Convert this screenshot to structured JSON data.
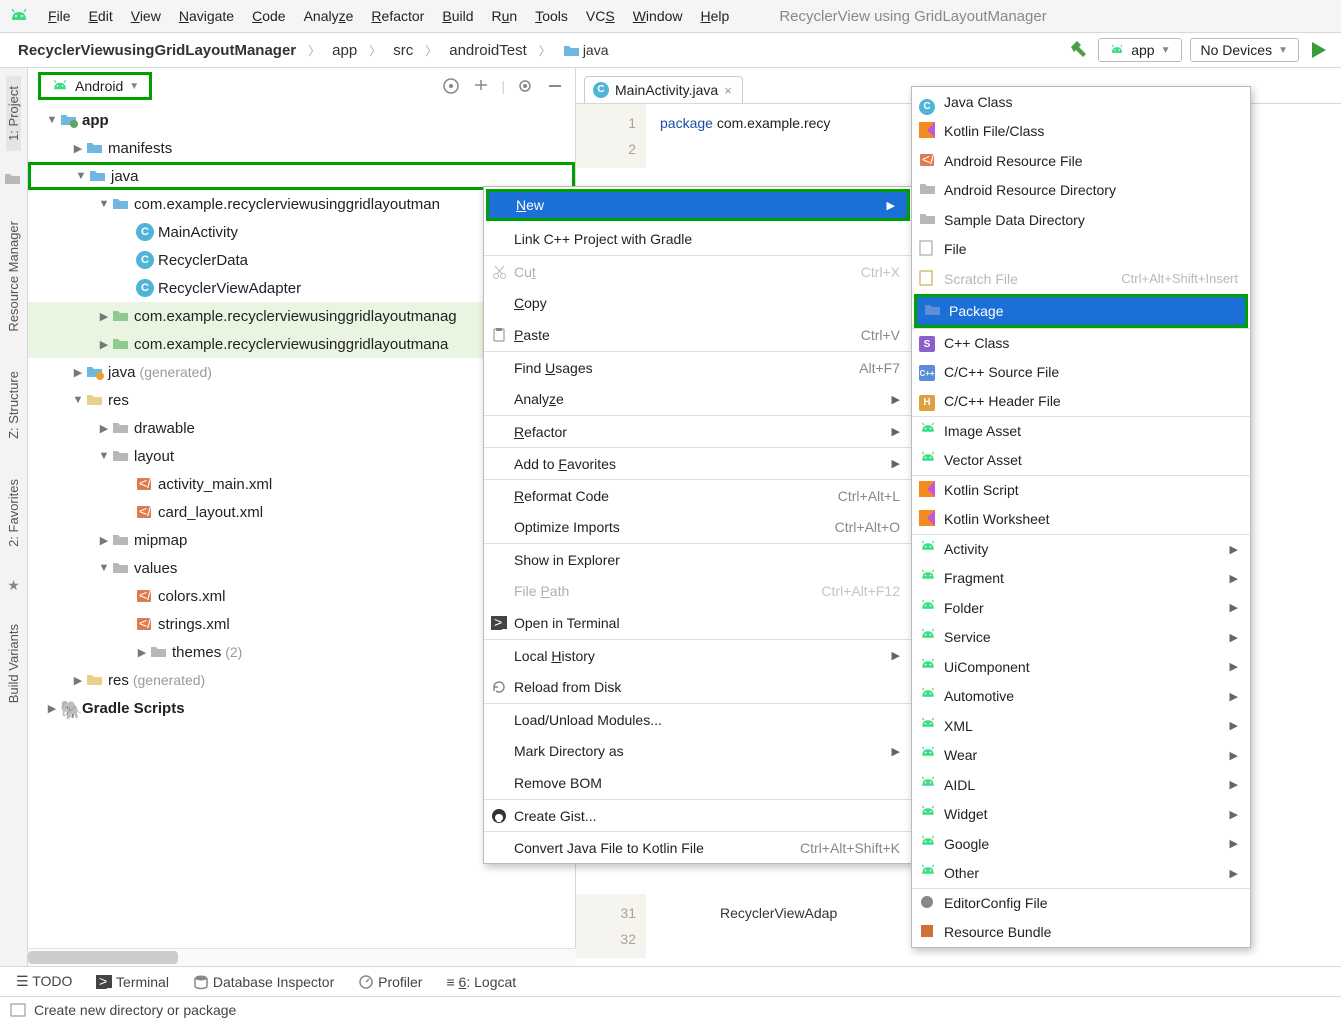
{
  "menubar": {
    "items": [
      "File",
      "Edit",
      "View",
      "Navigate",
      "Code",
      "Analyze",
      "Refactor",
      "Build",
      "Run",
      "Tools",
      "VCS",
      "Window",
      "Help"
    ],
    "hint": "RecyclerView using GridLayoutManager"
  },
  "breadcrumbs": {
    "project": "RecyclerViewusingGridLayoutManager",
    "parts": [
      "app",
      "src",
      "androidTest",
      "java"
    ]
  },
  "toolbar_right": {
    "config": "app",
    "devices": "No Devices"
  },
  "sidebar_tabs": {
    "top": "1: Project",
    "others": [
      "Resource Manager",
      "Z: Structure",
      "2: Favorites",
      "Build Variants"
    ]
  },
  "project_panel": {
    "selector": "Android",
    "tree": {
      "app": "app",
      "manifests": "manifests",
      "java": "java",
      "pkg1": "com.example.recyclerviewusinggridlayoutman",
      "cls": [
        "MainActivity",
        "RecyclerData",
        "RecyclerViewAdapter"
      ],
      "pkg_test1": "com.example.recyclerviewusinggridlayoutmanag",
      "pkg_test2": "com.example.recyclerviewusinggridlayoutmana",
      "java_gen": "java",
      "java_gen_suffix": "(generated)",
      "res": "res",
      "drawable": "drawable",
      "layout": "layout",
      "layout_files": [
        "activity_main.xml",
        "card_layout.xml"
      ],
      "mipmap": "mipmap",
      "values": "values",
      "values_files": [
        "colors.xml",
        "strings.xml"
      ],
      "themes": "themes",
      "themes_suffix": "(2)",
      "res_gen": "res",
      "res_gen_suffix": "(generated)",
      "gradle": "Gradle Scripts"
    }
  },
  "editor": {
    "tab": "MainActivity.java",
    "line1_kw": "package",
    "line1_rest": " com.example.recy",
    "gutter_first": [
      "1",
      "2"
    ],
    "gutter31": "31",
    "gutter32": "32",
    "line31": "RecyclerViewAdap"
  },
  "context_menu": [
    {
      "label": "New",
      "shortcut": "",
      "type": "new"
    },
    {
      "label": "Link C++ Project with Gradle",
      "type": "item",
      "sep": false
    },
    {
      "label": "Cut",
      "shortcut": "Ctrl+X",
      "type": "disabled",
      "sep": true,
      "icon": "cut"
    },
    {
      "label": "Copy",
      "shortcut": "",
      "type": "item"
    },
    {
      "label": "Paste",
      "shortcut": "Ctrl+V",
      "type": "item",
      "icon": "paste"
    },
    {
      "label": "Find Usages",
      "shortcut": "Alt+F7",
      "type": "item",
      "sep": true
    },
    {
      "label": "Analyze",
      "shortcut": "",
      "type": "submenu"
    },
    {
      "label": "Refactor",
      "shortcut": "",
      "type": "submenu",
      "sep": true
    },
    {
      "label": "Add to Favorites",
      "shortcut": "",
      "type": "submenu",
      "sep": true
    },
    {
      "label": "Reformat Code",
      "shortcut": "Ctrl+Alt+L",
      "type": "item",
      "sep": true
    },
    {
      "label": "Optimize Imports",
      "shortcut": "Ctrl+Alt+O",
      "type": "item"
    },
    {
      "label": "Show in Explorer",
      "shortcut": "",
      "type": "item",
      "sep": true
    },
    {
      "label": "File Path",
      "shortcut": "Ctrl+Alt+F12",
      "type": "disabled"
    },
    {
      "label": "Open in Terminal",
      "shortcut": "",
      "type": "item",
      "icon": "terminal"
    },
    {
      "label": "Local History",
      "shortcut": "",
      "type": "submenu",
      "sep": true
    },
    {
      "label": "Reload from Disk",
      "shortcut": "",
      "type": "item",
      "icon": "reload"
    },
    {
      "label": "Load/Unload Modules...",
      "shortcut": "",
      "type": "item",
      "sep": true
    },
    {
      "label": "Mark Directory as",
      "shortcut": "",
      "type": "submenu"
    },
    {
      "label": "Remove BOM",
      "shortcut": "",
      "type": "item"
    },
    {
      "label": "Create Gist...",
      "shortcut": "",
      "type": "item",
      "sep": true,
      "icon": "github"
    },
    {
      "label": "Convert Java File to Kotlin File",
      "shortcut": "Ctrl+Alt+Shift+K",
      "type": "item",
      "sep": true
    }
  ],
  "new_submenu": [
    {
      "label": "Java Class",
      "icon": "class-c"
    },
    {
      "label": "Kotlin File/Class",
      "icon": "kotlin"
    },
    {
      "label": "Android Resource File",
      "icon": "xml"
    },
    {
      "label": "Android Resource Directory",
      "icon": "folder-gray"
    },
    {
      "label": "Sample Data Directory",
      "icon": "folder-gray"
    },
    {
      "label": "File",
      "icon": "file"
    },
    {
      "label": "Scratch File",
      "icon": "scratch",
      "shortcut": "Ctrl+Alt+Shift+Insert",
      "disabled": true
    },
    {
      "label": "Package",
      "icon": "folder-blue",
      "highlight": true
    },
    {
      "label": "C++ Class",
      "icon": "cpp-s",
      "sep": true
    },
    {
      "label": "C/C++ Source File",
      "icon": "cpp-src"
    },
    {
      "label": "C/C++ Header File",
      "icon": "cpp-hdr"
    },
    {
      "label": "Image Asset",
      "icon": "android",
      "sep": true
    },
    {
      "label": "Vector Asset",
      "icon": "android"
    },
    {
      "label": "Kotlin Script",
      "icon": "kotlin",
      "sep": true
    },
    {
      "label": "Kotlin Worksheet",
      "icon": "kotlin"
    },
    {
      "label": "Activity",
      "icon": "android",
      "sub": true,
      "sep": true
    },
    {
      "label": "Fragment",
      "icon": "android",
      "sub": true
    },
    {
      "label": "Folder",
      "icon": "android",
      "sub": true
    },
    {
      "label": "Service",
      "icon": "android",
      "sub": true
    },
    {
      "label": "UiComponent",
      "icon": "android",
      "sub": true
    },
    {
      "label": "Automotive",
      "icon": "android",
      "sub": true
    },
    {
      "label": "XML",
      "icon": "android",
      "sub": true
    },
    {
      "label": "Wear",
      "icon": "android",
      "sub": true
    },
    {
      "label": "AIDL",
      "icon": "android",
      "sub": true
    },
    {
      "label": "Widget",
      "icon": "android",
      "sub": true
    },
    {
      "label": "Google",
      "icon": "android",
      "sub": true
    },
    {
      "label": "Other",
      "icon": "android",
      "sub": true
    },
    {
      "label": "EditorConfig File",
      "icon": "editorconfig",
      "sep": true
    },
    {
      "label": "Resource Bundle",
      "icon": "bundle"
    }
  ],
  "bottombar": {
    "items": [
      "TODO",
      "Terminal",
      "Database Inspector",
      "Profiler",
      "6: Logcat"
    ]
  },
  "statusbar": {
    "text": "Create new directory or package"
  }
}
